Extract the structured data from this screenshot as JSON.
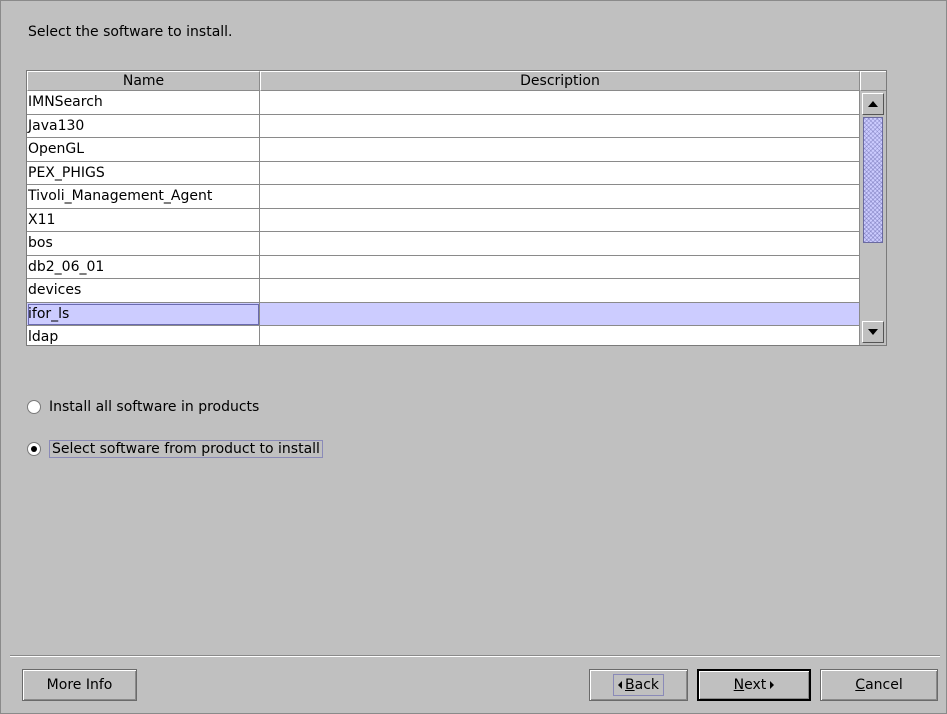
{
  "dialog": {
    "title": "Select the software to install."
  },
  "table": {
    "columns": [
      "Name",
      "Description"
    ],
    "rows": [
      {
        "name": "IMNSearch",
        "description": ""
      },
      {
        "name": "Java130",
        "description": ""
      },
      {
        "name": "OpenGL",
        "description": ""
      },
      {
        "name": "PEX_PHIGS",
        "description": ""
      },
      {
        "name": "Tivoli_Management_Agent",
        "description": ""
      },
      {
        "name": "X11",
        "description": ""
      },
      {
        "name": "bos",
        "description": ""
      },
      {
        "name": "db2_06_01",
        "description": ""
      },
      {
        "name": "devices",
        "description": ""
      },
      {
        "name": "ifor_ls",
        "description": ""
      },
      {
        "name": "ldap",
        "description": ""
      }
    ],
    "selected_row": "ifor_ls"
  },
  "options": {
    "install_all": {
      "label": "Install all software in products",
      "checked": false
    },
    "select_software": {
      "label": "Select software from product to install",
      "checked": true
    }
  },
  "buttons": {
    "more_info": "More Info",
    "back_mnemonic": "B",
    "back_rest": "ack",
    "next_mnemonic": "N",
    "next_rest": "ext",
    "cancel_mnemonic": "C",
    "cancel_rest": "ancel"
  },
  "colors": {
    "background": "#c0c0c0",
    "selection": "#ccccff"
  }
}
